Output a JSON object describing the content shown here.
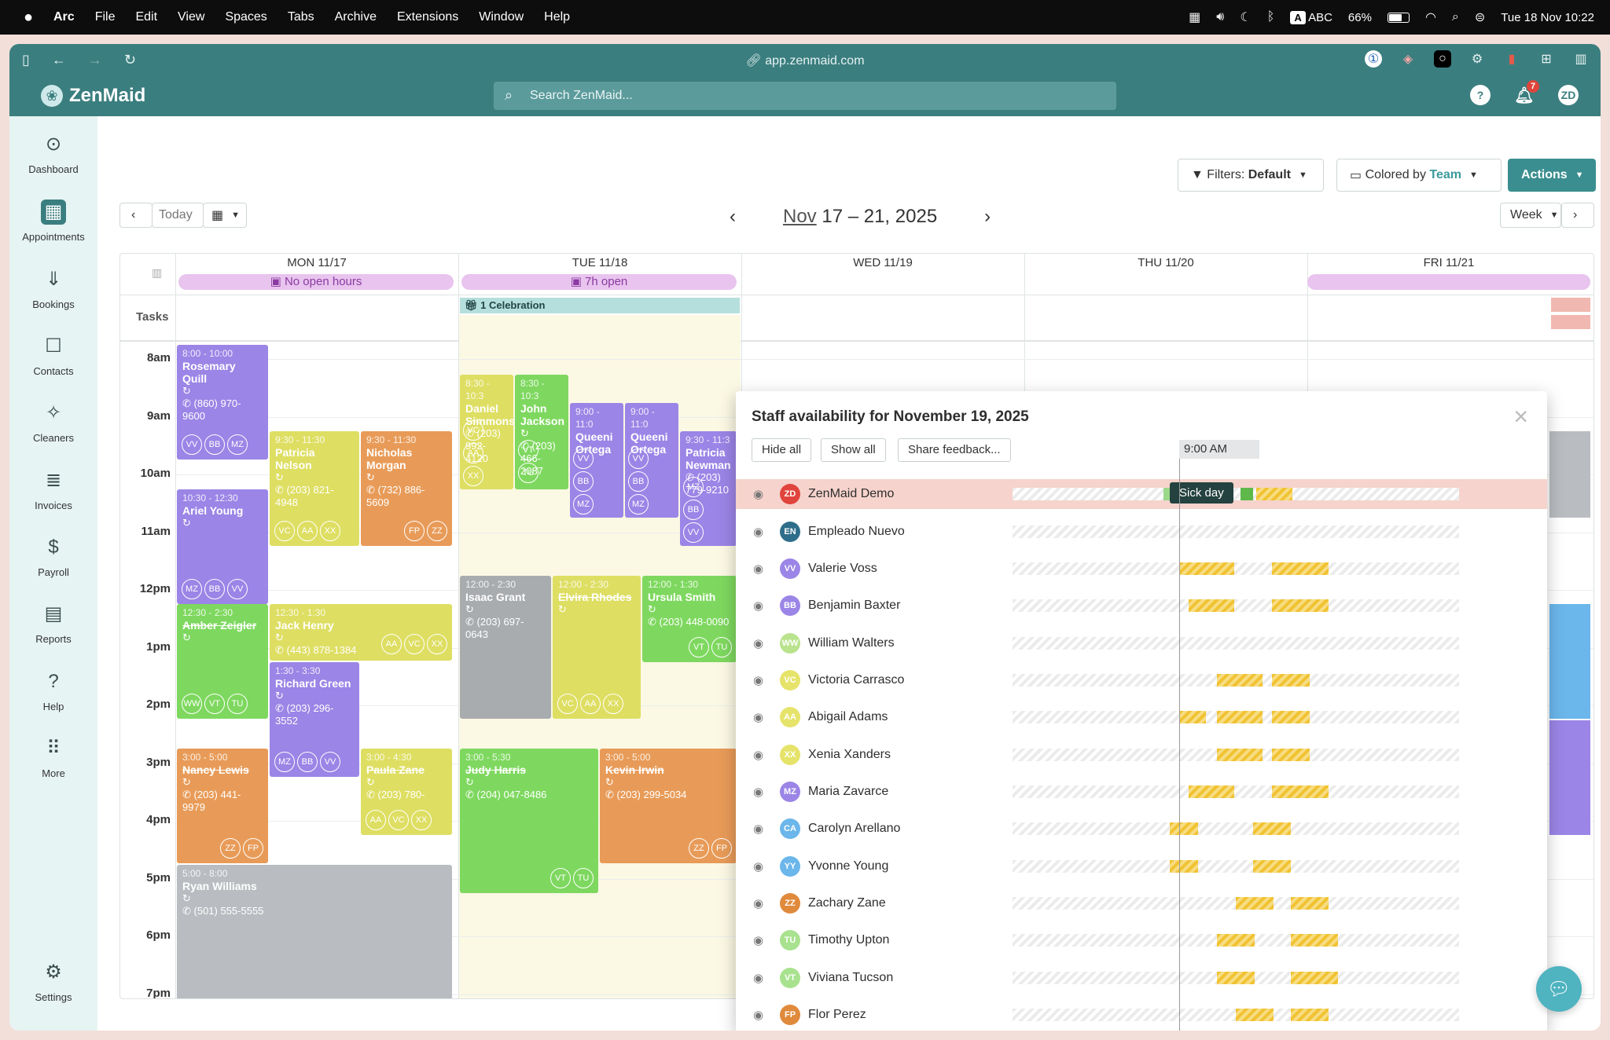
{
  "menubar": {
    "app": "Arc",
    "items": [
      "File",
      "Edit",
      "View",
      "Spaces",
      "Tabs",
      "Archive",
      "Extensions",
      "Window",
      "Help"
    ],
    "input_source": "ABC",
    "input_letter": "A",
    "battery": "66%",
    "clock": "Tue 18 Nov  10:22"
  },
  "browser": {
    "url": "app.zenmaid.com"
  },
  "app": {
    "brand": "ZenMaid",
    "search_placeholder": "Search ZenMaid...",
    "notifications": "7",
    "user_initials": "ZD"
  },
  "sidebar": [
    {
      "label": "Dashboard",
      "icon": "dashboard-icon",
      "glyph": "⊙"
    },
    {
      "label": "Appointments",
      "icon": "calendar-icon",
      "glyph": "▦"
    },
    {
      "label": "Bookings",
      "icon": "inbox-icon",
      "glyph": "⇓"
    },
    {
      "label": "Contacts",
      "icon": "contact-icon",
      "glyph": "☐"
    },
    {
      "label": "Cleaners",
      "icon": "cleaners-icon",
      "glyph": "✧"
    },
    {
      "label": "Invoices",
      "icon": "invoice-icon",
      "glyph": "≣"
    },
    {
      "label": "Payroll",
      "icon": "payroll-icon",
      "glyph": "$"
    },
    {
      "label": "Reports",
      "icon": "reports-icon",
      "glyph": "▤"
    },
    {
      "label": "Help",
      "icon": "help-icon",
      "glyph": "?"
    },
    {
      "label": "More",
      "icon": "more-icon",
      "glyph": "⠿"
    },
    {
      "label": "Settings",
      "icon": "gear-icon",
      "glyph": "⚙"
    }
  ],
  "toolbar": {
    "filters_label": "Filters:",
    "filters_value": "Default",
    "colored_label": "Colored by",
    "colored_value": "Team",
    "actions": "Actions",
    "today": "Today",
    "month": "Nov",
    "range": "17 – 21, 2025",
    "view": "Week"
  },
  "calendar": {
    "days": [
      "MON 11/17",
      "TUE 11/18",
      "WED 11/19",
      "THU 11/20",
      "FRI 11/21"
    ],
    "pills": [
      "No open hours",
      "7h open"
    ],
    "tasks_label": "Tasks",
    "celebration": "1 Celebration",
    "hours": [
      "8am",
      "9am",
      "10am",
      "11am",
      "12pm",
      "1pm",
      "2pm",
      "3pm",
      "4pm",
      "5pm",
      "6pm",
      "7pm"
    ]
  },
  "appointments": [
    {
      "time": "8:00 - 10:00",
      "name": "Rosemary Quill",
      "phone": "(860) 970-9600",
      "chips": [
        "VV",
        "BB",
        "MZ"
      ]
    },
    {
      "time": "9:30 - 11:30",
      "name": "Patricia Nelson",
      "phone": "(203) 821-4948",
      "chips": [
        "VC",
        "AA",
        "XX"
      ]
    },
    {
      "time": "9:30 - 11:30",
      "name": "Nicholas Morgan",
      "phone": "(732) 886-5609",
      "chips": [
        "FP",
        "ZZ"
      ]
    },
    {
      "time": "10:30 - 12:30",
      "name": "Ariel Young",
      "phone": "",
      "chips": [
        "MZ",
        "BB",
        "VV"
      ]
    },
    {
      "time": "12:30 - 2:30",
      "name": "Amber Zeigler",
      "phone": "",
      "chips": [
        "WW",
        "VT",
        "TU"
      ]
    },
    {
      "time": "12:30 - 1:30",
      "name": "Jack Henry",
      "phone": "(443) 878-1384",
      "chips": [
        "AA",
        "VC",
        "XX"
      ]
    },
    {
      "time": "1:30 - 3:30",
      "name": "Richard Green",
      "phone": "(203) 296-3552",
      "chips": [
        "MZ",
        "BB",
        "VV"
      ]
    },
    {
      "time": "3:00 - 5:00",
      "name": "Nancy Lewis",
      "phone": "(203) 441-9979",
      "chips": [
        "ZZ",
        "FP"
      ]
    },
    {
      "time": "3:00 - 4:30",
      "name": "Paula Zane",
      "phone": "(203) 780-",
      "chips": [
        "AA",
        "VC",
        "XX"
      ]
    },
    {
      "time": "5:00 - 8:00",
      "name": "Ryan Williams",
      "phone": "(501) 555-5555",
      "chips": []
    },
    {
      "time": "8:30 - 10:3",
      "name": "Daniel Simmons",
      "phone": "(203) 992-4120",
      "chips": [
        "VC",
        "AA",
        "XX"
      ]
    },
    {
      "time": "8:30 - 10:3",
      "name": "John Jackson",
      "phone": "(203) 466-2087",
      "chips": [
        "VT",
        "TU"
      ]
    },
    {
      "time": "9:00 - 11:0",
      "name": "Queeni Ortega",
      "phone": "",
      "chips": [
        "VV",
        "BB",
        "MZ"
      ]
    },
    {
      "time": "9:00 - 11:0",
      "name": "Queeni Ortega",
      "phone": "",
      "chips": [
        "VV",
        "BB",
        "MZ"
      ]
    },
    {
      "time": "9:30 - 11:3",
      "name": "Patricia Newman",
      "phone": "(203) 779-9210",
      "chips": [
        "MZ",
        "BB",
        "VV"
      ]
    },
    {
      "time": "12:00 - 2:30",
      "name": "Isaac Grant",
      "phone": "(203) 697-0643",
      "chips": []
    },
    {
      "time": "12:00 - 2:30",
      "name": "Elvira Rhodes",
      "phone": "",
      "chips": [
        "VC",
        "AA",
        "XX"
      ]
    },
    {
      "time": "12:00 - 1:30",
      "name": "Ursula Smith",
      "phone": "(203) 448-0090",
      "chips": [
        "VT",
        "TU"
      ]
    },
    {
      "time": "3:00 - 5:30",
      "name": "Judy Harris",
      "phone": "(204) 047-8486",
      "chips": [
        "VT",
        "TU"
      ]
    },
    {
      "time": "3:00 - 5:00",
      "name": "Kevin Irwin",
      "phone": "(203) 299-5034",
      "chips": [
        "ZZ",
        "FP"
      ]
    }
  ],
  "availability": {
    "title": "Staff availability for November 19, 2025",
    "hide_all": "Hide all",
    "show_all": "Show all",
    "feedback": "Share feedback...",
    "time_label": "9:00 AM",
    "sick_label": "Sick day",
    "staff": [
      {
        "initials": "ZD",
        "name": "ZenMaid Demo",
        "color": "#e0443c"
      },
      {
        "initials": "EN",
        "name": "Empleado Nuevo",
        "color": "#2f6e8a"
      },
      {
        "initials": "VV",
        "name": "Valerie Voss",
        "color": "#9b85e6"
      },
      {
        "initials": "BB",
        "name": "Benjamin Baxter",
        "color": "#9b85e6"
      },
      {
        "initials": "WW",
        "name": "William Walters",
        "color": "#b9e38c"
      },
      {
        "initials": "VC",
        "name": "Victoria Carrasco",
        "color": "#e6e36b"
      },
      {
        "initials": "AA",
        "name": "Abigail Adams",
        "color": "#e6e36b"
      },
      {
        "initials": "XX",
        "name": "Xenia Xanders",
        "color": "#e6e36b"
      },
      {
        "initials": "MZ",
        "name": "Maria Zavarce",
        "color": "#9b85e6"
      },
      {
        "initials": "CA",
        "name": "Carolyn Arellano",
        "color": "#6bb6ea"
      },
      {
        "initials": "YY",
        "name": "Yvonne Young",
        "color": "#6bb6ea"
      },
      {
        "initials": "ZZ",
        "name": "Zachary Zane",
        "color": "#e08a3c"
      },
      {
        "initials": "TU",
        "name": "Timothy Upton",
        "color": "#a8e28e"
      },
      {
        "initials": "VT",
        "name": "Viviana Tucson",
        "color": "#a8e28e"
      },
      {
        "initials": "FP",
        "name": "Flor Perez",
        "color": "#e08a3c"
      }
    ]
  }
}
